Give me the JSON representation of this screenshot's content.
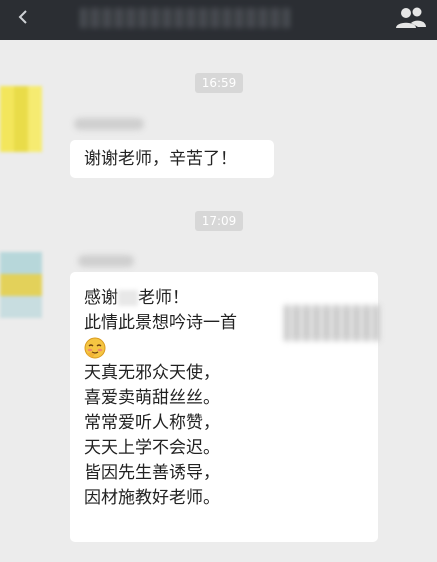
{
  "header": {
    "back_icon": "chevron-left-icon",
    "contacts_icon": "group-icon"
  },
  "messages": [
    {
      "time": "16:59",
      "text": "谢谢老师，辛苦了！"
    },
    {
      "time": "17:09",
      "lines": [
        "感谢",
        "老师！",
        "此情此景想吟诗一首",
        "天真无邪众天使，",
        "喜爱卖萌甜丝丝。",
        "常常爱听人称赞，",
        "天天上学不会迟。",
        "皆因先生善诱导，",
        "因材施教好老师。"
      ],
      "emoji": "blushing-face-emoji"
    }
  ],
  "colors": {
    "titlebar": "#2b2e33",
    "background": "#ececec",
    "bubble": "#ffffff",
    "timestamp_bg": "#d7d7d7"
  }
}
